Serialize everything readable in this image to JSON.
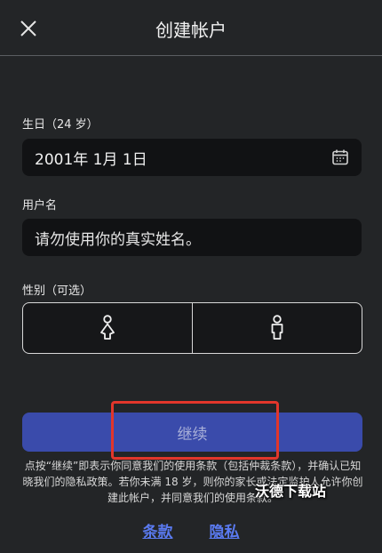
{
  "header": {
    "title": "创建帐户",
    "close_icon": "close-icon"
  },
  "birthday": {
    "label": "生日（24 岁）",
    "value": "2001年 1月 1日",
    "icon": "calendar-icon"
  },
  "username": {
    "label": "用户名",
    "placeholder": "请勿使用你的真实姓名。"
  },
  "gender": {
    "label": "性别（可选）",
    "options": [
      {
        "icon": "female-icon"
      },
      {
        "icon": "male-icon"
      }
    ]
  },
  "continue": {
    "label": "继续"
  },
  "legal": {
    "text": "点按“继续”即表示你同意我们的使用条款（包括仲裁条款），并确认已知晓我们的隐私政策。若你未满 18 岁，则你的家长或法定监护人允许你创建此帐户，并同意我们的使用条款。"
  },
  "links": {
    "terms": "条款",
    "privacy": "隐私"
  },
  "watermark": {
    "text": "沃德下载站"
  },
  "colors": {
    "background": "#232527",
    "field": "#111214",
    "button": "#3a4bab",
    "link": "#5a7af0",
    "highlight": "#e2362b"
  }
}
